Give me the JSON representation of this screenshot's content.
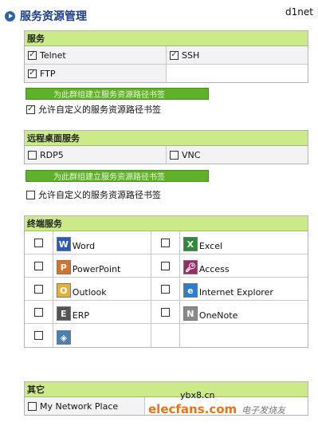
{
  "page": {
    "title": "服务资源管理",
    "watermark": "d1net"
  },
  "services": {
    "header": "服务",
    "items": [
      {
        "label": "Telnet",
        "checked": true
      },
      {
        "label": "SSH",
        "checked": true
      },
      {
        "label": "FTP",
        "checked": true
      }
    ],
    "bookmark_button": "为此群组建立服务资源路径书签",
    "allow_custom": {
      "label": "允许自定义的服务资源路径书签",
      "checked": true
    }
  },
  "remote_desktop": {
    "header": "远程桌面服务",
    "items": [
      {
        "label": "RDP5",
        "checked": false
      },
      {
        "label": "VNC",
        "checked": false
      }
    ],
    "bookmark_button": "为此群组建立服务资源路径书签",
    "allow_custom": {
      "label": "允许自定义的服务资源路径书签",
      "checked": false
    }
  },
  "terminal": {
    "header": "终端服务",
    "rows": [
      [
        {
          "label": "Word",
          "icon": "word-icon",
          "color": "#2a5bb5"
        },
        {
          "label": "Excel",
          "icon": "excel-icon",
          "color": "#2d8a36"
        }
      ],
      [
        {
          "label": "PowerPoint",
          "icon": "powerpoint-icon",
          "color": "#d8722a"
        },
        {
          "label": "Access",
          "icon": "access-icon",
          "color": "#9b2a6a"
        }
      ],
      [
        {
          "label": "Outlook",
          "icon": "outlook-icon",
          "color": "#e3b23c"
        },
        {
          "label": "Internet Explorer",
          "icon": "ie-icon",
          "color": "#2a7fd1"
        }
      ],
      [
        {
          "label": "ERP",
          "icon": "erp-icon",
          "color": "#555555"
        },
        {
          "label": "OneNote",
          "icon": "onenote-icon",
          "color": "#8a8a8a"
        }
      ],
      [
        {
          "label": "",
          "icon": "generic-app-icon",
          "color": "#4a7fb8"
        },
        null
      ]
    ]
  },
  "other": {
    "header": "其它",
    "items": [
      {
        "label": "My Network Place",
        "checked": false
      }
    ]
  },
  "footer_watermarks": {
    "brand": "elecfans.com",
    "site": "ybx8.cn",
    "chinese": "电子发烧友"
  }
}
